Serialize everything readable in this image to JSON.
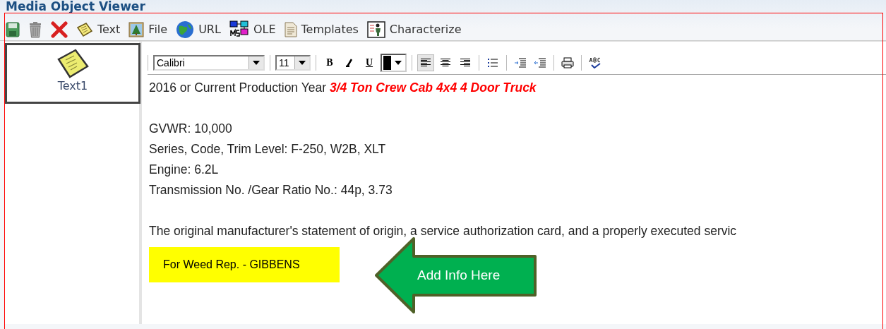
{
  "window": {
    "title": "Media Object Viewer"
  },
  "toolbar": {
    "buttons": [
      {
        "kind": "save"
      },
      {
        "kind": "delete"
      },
      {
        "kind": "remove"
      },
      {
        "kind": "text",
        "label": "Text"
      },
      {
        "kind": "file",
        "label": "File"
      },
      {
        "kind": "url",
        "label": "URL"
      },
      {
        "kind": "ole",
        "label": "OLE"
      },
      {
        "kind": "templates",
        "label": "Templates"
      },
      {
        "kind": "characterize",
        "label": "Characterize"
      }
    ]
  },
  "objects": [
    {
      "label": "Text1",
      "selected": true
    }
  ],
  "editor": {
    "font_field": {
      "value": "Calibri"
    },
    "size_field": {
      "value": "11"
    },
    "format_buttons": [
      {
        "kind": "bold",
        "label": "B"
      },
      {
        "kind": "italic"
      },
      {
        "kind": "underline",
        "label": "U"
      }
    ],
    "text_color": {
      "color": "#000000"
    },
    "align_buttons": [
      {
        "kind": "left",
        "selected": true
      },
      {
        "kind": "center",
        "selected": false
      },
      {
        "kind": "right",
        "selected": false
      }
    ],
    "tool_buttons": [
      {
        "kind": "bullets"
      },
      {
        "kind": "indent"
      },
      {
        "kind": "outdent"
      },
      {
        "kind": "print"
      },
      {
        "kind": "spell"
      }
    ],
    "lines": [
      {
        "kind": "text",
        "parts": [
          {
            "text": "2016 or Current Production Year ",
            "highlight": false
          },
          {
            "text": "3/4 Ton Crew Cab 4x4 4 Door Truck",
            "highlight": true
          }
        ]
      },
      {
        "kind": "blank"
      },
      {
        "kind": "text",
        "parts": [
          {
            "text": "GVWR: 10,000",
            "highlight": false
          }
        ]
      },
      {
        "kind": "text",
        "parts": [
          {
            "text": "Series,  Code, Trim Level:  F-250, W2B, XLT",
            "highlight": false
          }
        ]
      },
      {
        "kind": "text",
        "parts": [
          {
            "text": "Engine:  6.2L",
            "highlight": false
          }
        ]
      },
      {
        "kind": "text",
        "parts": [
          {
            "text": "Transmission No. /Gear Ratio No.: 44p, 3.73",
            "highlight": false
          }
        ]
      },
      {
        "kind": "blank"
      },
      {
        "kind": "text",
        "parts": [
          {
            "text": "The original manufacturer's statement of origin, a service authorization card, and a properly executed servic",
            "highlight": false
          }
        ]
      }
    ],
    "note": {
      "text": "For Weed Rep. - GIBBENS"
    },
    "callout": {
      "text": "Add Info Here"
    }
  }
}
